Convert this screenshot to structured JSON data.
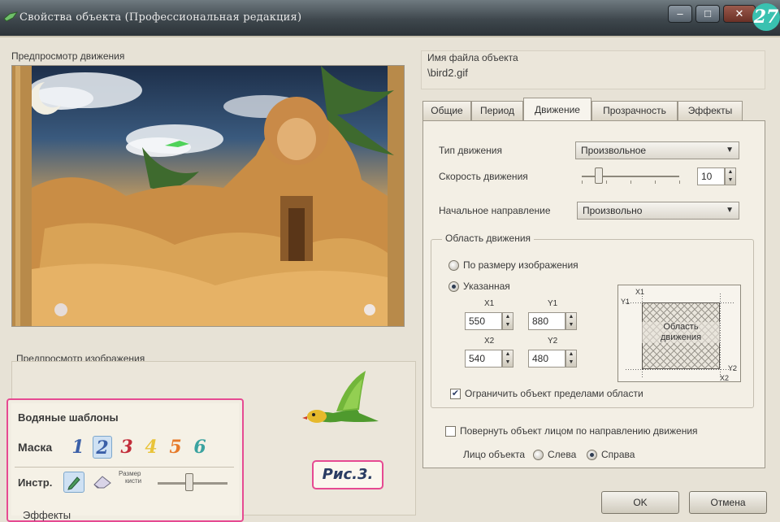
{
  "window": {
    "title": "Свойства объекта (Профессиональная редакция)",
    "page_number": "27"
  },
  "left": {
    "motion_preview_label": "Предпросмотр движения",
    "image_preview_label": "Предпросмотр изображения",
    "watermark": {
      "title": "Водяные шаблоны",
      "mask_label": "Маска",
      "masks": [
        "1",
        "2",
        "3",
        "4",
        "5",
        "6"
      ],
      "mask_colors": [
        "#3a5fa8",
        "#3a5fa8",
        "#c22d3a",
        "#e9c43a",
        "#e67a2a",
        "#3ba3a0"
      ],
      "selected_mask": "2",
      "tool_label": "Инстр.",
      "brush_size_label_line1": "Размер",
      "brush_size_label_line2": "кисти",
      "brush_size_level": 0.45
    },
    "effects_label": "Эффекты",
    "figure_caption": "Рис.3."
  },
  "right": {
    "filename_label": "Имя файла объекта",
    "filename_value": "\\bird2.gif",
    "tabs": [
      "Общие",
      "Период",
      "Движение",
      "Прозрачность",
      "Эффекты"
    ],
    "active_tab": "Движение",
    "motion_type_label": "Тип движения",
    "motion_type_value": "Произвольное",
    "speed_label": "Скорость движения",
    "speed_value": "10",
    "start_direction_label": "Начальное направление",
    "start_direction_value": "Произвольно",
    "area_group_title": "Область движения",
    "radio_image_size": "По размеру изображения",
    "radio_specified": "Указанная",
    "x1_label": "X1",
    "x1_value": "550",
    "y1_label": "Y1",
    "y1_value": "880",
    "x2_label": "X2",
    "x2_value": "540",
    "y2_label": "Y2",
    "y2_value": "480",
    "diagram": {
      "area_text_line1": "Область",
      "area_text_line2": "движения",
      "x1": "X1",
      "y1": "Y1",
      "x2": "X2",
      "y2": "Y2"
    },
    "limit_checkbox_label": "Ограничить объект пределами области",
    "limit_checked": true,
    "rotate_checkbox_label": "Повернуть объект лицом по направлению движения",
    "rotate_checked": false,
    "face_label": "Лицо объекта",
    "face_left": "Слева",
    "face_right": "Справа",
    "face_selected": "Справа",
    "ok_label": "OK",
    "cancel_label": "Отмена"
  },
  "colors": {
    "accent_pink": "#e64a92",
    "badge_teal": "#39c1b0",
    "caption_text": "#2a3c63"
  }
}
